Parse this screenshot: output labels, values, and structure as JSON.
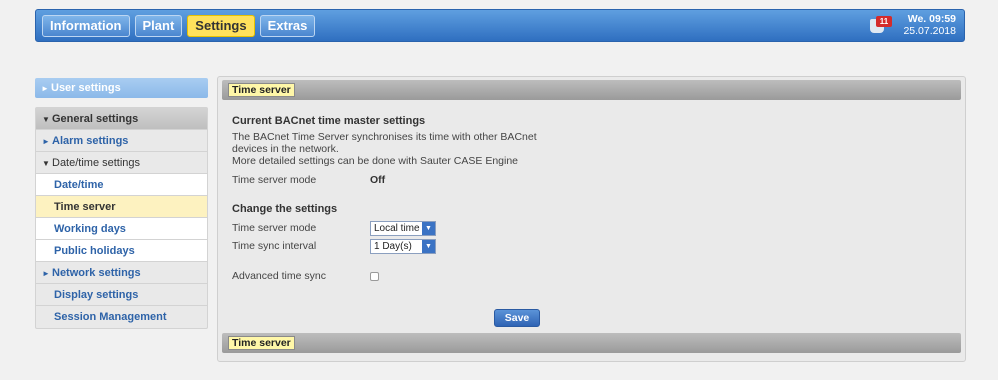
{
  "tabs": [
    {
      "label": "Information"
    },
    {
      "label": "Plant"
    },
    {
      "label": "Settings"
    },
    {
      "label": "Extras"
    }
  ],
  "alarm": {
    "count": "11",
    "icon": "alarm-bell-icon"
  },
  "clock": {
    "day_time": "We. 09:59",
    "date": "25.07.2018"
  },
  "sidebar": {
    "user_settings": "User settings",
    "general_settings": "General settings",
    "alarm_settings": "Alarm settings",
    "datetime_settings": "Date/time settings",
    "items": [
      "Date/time",
      "Time server",
      "Working days",
      "Public holidays"
    ],
    "network_settings": "Network settings",
    "display_settings": "Display settings",
    "session_management": "Session Management"
  },
  "panel": {
    "title_top": "Time server",
    "title_bottom": "Time server",
    "current_heading": "Current BACnet time master settings",
    "desc_line1": "The BACnet Time Server synchronises its time with other BACnet",
    "desc_line2": "devices in the network.",
    "desc_line3": "More detailed settings can be done with Sauter CASE Engine",
    "mode_label": "Time server mode",
    "mode_value": "Off",
    "change_heading": "Change the settings",
    "change_mode_label": "Time server mode",
    "change_mode_value": "Local time",
    "sync_label": "Time sync interval",
    "sync_value": "1 Day(s)",
    "advanced_label": "Advanced time sync",
    "save_label": "Save"
  }
}
